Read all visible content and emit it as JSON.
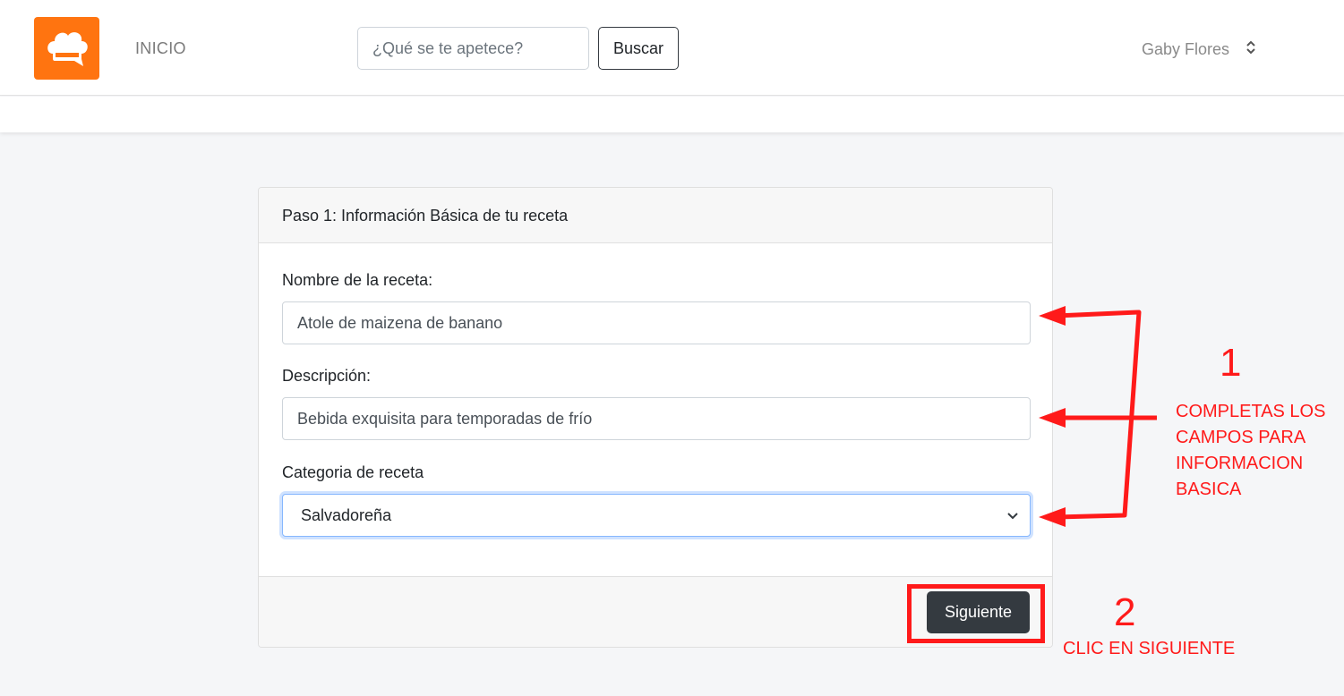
{
  "navbar": {
    "logo_icon": "chef-hat-chat-icon",
    "brand_color": "#ff7410",
    "nav_inicio": "INICIO",
    "search_placeholder": "¿Qué se te apetece?",
    "search_button": "Buscar",
    "user_name": "Gaby Flores",
    "user_menu_icon": "chevron-updown-icon"
  },
  "card": {
    "header": "Paso 1: Información Básica de tu receta",
    "name_label": "Nombre de la receta:",
    "name_value": "Atole de maizena de banano",
    "description_label": "Descripción:",
    "description_value": "Bebida exquisita para temporadas de frío",
    "category_label": "Categoria de receta",
    "category_selected": "Salvadoreña",
    "next_button": "Siguiente"
  },
  "annotations": {
    "step1_number": "1",
    "step1_text": [
      "COMPLETAS LOS",
      "CAMPOS PARA",
      "INFORMACION",
      "BASICA"
    ],
    "step2_number": "2",
    "step2_text": "CLIC EN SIGUIENTE",
    "color": "#ff1a1a"
  }
}
